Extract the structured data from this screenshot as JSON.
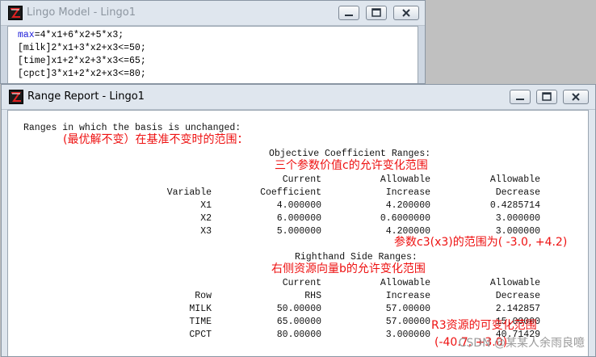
{
  "model_window": {
    "title": "Lingo Model - Lingo1",
    "code_lines": [
      {
        "keyword": "max",
        "rest": "=4*x1+6*x2+5*x3;"
      },
      {
        "keyword": "",
        "rest": "[milk]2*x1+3*x2+x3<=50;"
      },
      {
        "keyword": "",
        "rest": "[time]x1+2*x2+3*x3<=65;"
      },
      {
        "keyword": "",
        "rest": "[cpct]3*x1+2*x2+x3<=80;"
      }
    ]
  },
  "report_window": {
    "title": "Range Report - Lingo1",
    "heading": "Ranges in which the basis is unchanged:",
    "objective": {
      "title": "Objective Coefficient Ranges:",
      "header1": [
        "",
        "Current",
        "Allowable",
        "Allowable"
      ],
      "header2": [
        "Variable",
        "Coefficient",
        "Increase",
        "Decrease"
      ],
      "rows": [
        [
          "X1",
          "4.000000",
          "4.200000",
          "0.4285714"
        ],
        [
          "X2",
          "6.000000",
          "0.6000000",
          "3.000000"
        ],
        [
          "X3",
          "5.000000",
          "4.200000",
          "3.000000"
        ]
      ]
    },
    "rhs": {
      "title": "Righthand Side Ranges:",
      "header1": [
        "",
        "Current",
        "Allowable",
        "Allowable"
      ],
      "header2": [
        "Row",
        "RHS",
        "Increase",
        "Decrease"
      ],
      "rows": [
        [
          "MILK",
          "50.00000",
          "57.00000",
          "2.142857"
        ],
        [
          "TIME",
          "65.00000",
          "57.00000",
          "15.00000"
        ],
        [
          "CPCT",
          "80.00000",
          "3.000000",
          "40.71429"
        ]
      ]
    }
  },
  "annotations": {
    "basis_note": "(最优解不变）在基准不变时的范围：",
    "objective_note": "三个参数价值c的允许变化范围",
    "c3_note": "参数c3(x3)的范围为( -3.0, +4.2)",
    "rhs_note": "右侧资源向量b的允许变化范围",
    "r3_note_line1": "R3资源的可变化范围",
    "r3_note_line2": "(-40.7, +3.0)"
  },
  "watermark": "CSDN @某某人余雨良噫",
  "colors": {
    "annotation": "#ee1111",
    "keyword": "#1a1ad8",
    "titlebar": "#dfe6ee"
  }
}
